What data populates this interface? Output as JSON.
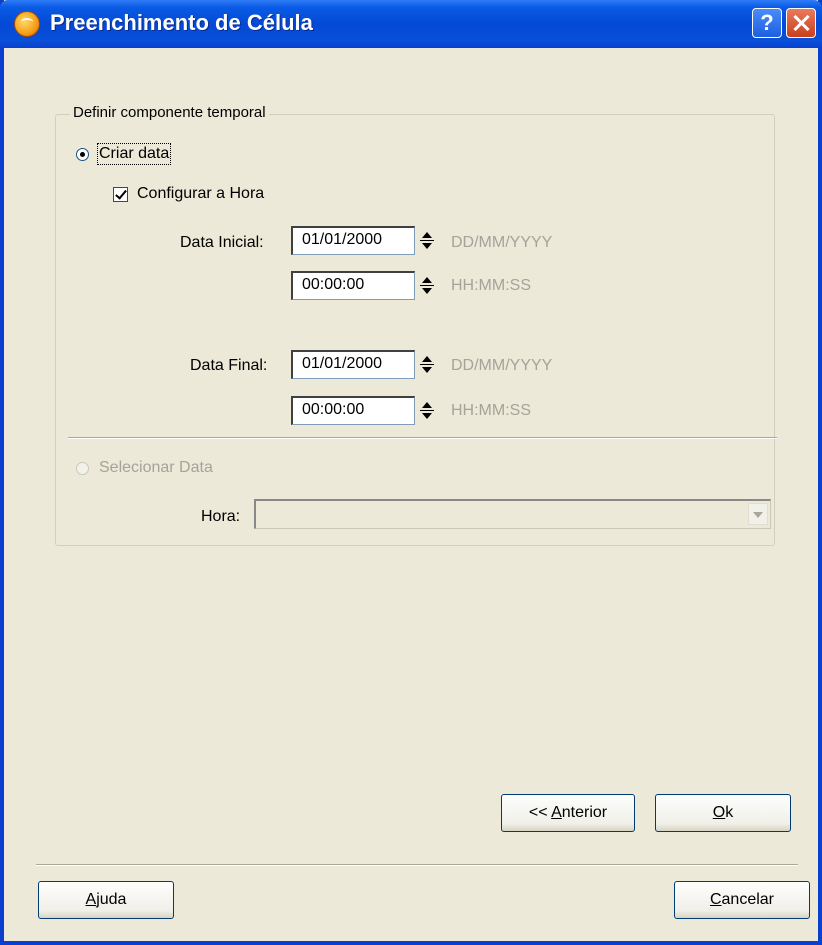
{
  "window": {
    "title": "Preenchimento de Célula",
    "help_glyph": "?"
  },
  "group": {
    "legend": "Definir componente temporal"
  },
  "options": {
    "create_date_label": "Criar data",
    "configure_time_label": "Configurar a Hora",
    "select_date_label": "Selecionar Data"
  },
  "start": {
    "label": "Data Inicial:",
    "date_value": "01/01/2000",
    "date_format": "DD/MM/YYYY",
    "time_value": "00:00:00",
    "time_format": "HH:MM:SS"
  },
  "end": {
    "label": "Data Final:",
    "date_value": "01/01/2000",
    "date_format": "DD/MM/YYYY",
    "time_value": "00:00:00",
    "time_format": "HH:MM:SS"
  },
  "hora": {
    "label": "Hora:",
    "value": ""
  },
  "buttons": {
    "previous": {
      "prefix": "<< ",
      "accel": "A",
      "rest": "nterior"
    },
    "ok": {
      "accel": "O",
      "rest": "k"
    },
    "help": {
      "accel": "A",
      "rest": "juda"
    },
    "cancel": {
      "accel": "C",
      "rest": "ancelar"
    }
  },
  "colors": {
    "titlebar": "#0a4fd8",
    "dialog_bg": "#ece9d8",
    "disabled_text": "#a5a39a"
  }
}
